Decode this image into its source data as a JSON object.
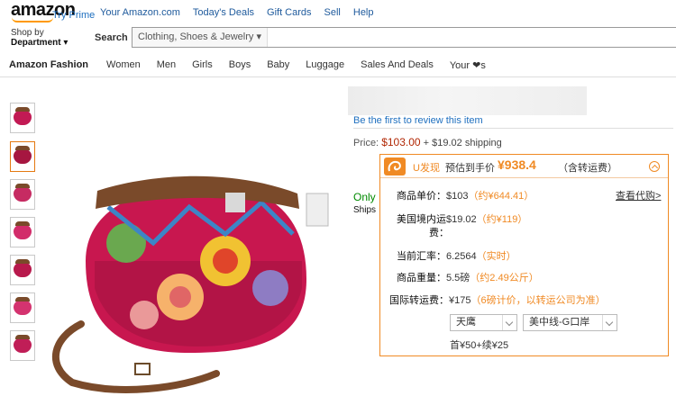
{
  "header": {
    "logo": "amazon",
    "try_prime": "Try Prime",
    "nav": [
      "Your Amazon.com",
      "Today's Deals",
      "Gift Cards",
      "Sell",
      "Help"
    ],
    "shop_by_line1": "Shop by",
    "shop_by_line2": "Department",
    "search_label": "Search",
    "search_category": "Clothing, Shoes & Jewelry",
    "search_value": ""
  },
  "subnav": {
    "brand": "Amazon Fashion",
    "items": [
      "Women",
      "Men",
      "Girls",
      "Boys",
      "Baby",
      "Luggage",
      "Sales And Deals",
      "Your ❤s"
    ]
  },
  "thumbnails": {
    "count": 7,
    "active_index": 1
  },
  "product": {
    "review_link": "Be the first to review this item",
    "price_label": "Price:",
    "price": "$103.00",
    "shipping": "+ $19.02 shipping",
    "stock_prefix": "Only",
    "ships_prefix": "Ships"
  },
  "popup": {
    "brand": "U发现",
    "est_label": "预估到手价",
    "total": "¥938.4",
    "total_note": "（含转运费）",
    "view_code": "查看代购>",
    "rows": [
      {
        "label": "商品单价：",
        "value": "$103",
        "extra": "（约¥644.41）"
      },
      {
        "label": "美国境内运",
        "label2": "费：",
        "value": "$19.02",
        "extra": "（约¥119）"
      },
      {
        "label": "当前汇率：",
        "value": "6.2564",
        "extra": "（实时）"
      },
      {
        "label": "商品重量：",
        "value": "5.5磅",
        "extra": "（约2.49公斤）"
      },
      {
        "label": "国际转运费：",
        "value": "¥175",
        "extra": "（6磅计价，以转运公司为准）"
      }
    ],
    "select_warehouse": "天鹰",
    "select_route": "美中线-G口岸",
    "formula": "首¥50+续¥25"
  },
  "colors": {
    "accent_orange": "#f08a24",
    "price_red": "#b12704",
    "link_blue": "#1e6fbf",
    "stock_green": "#008a00"
  }
}
